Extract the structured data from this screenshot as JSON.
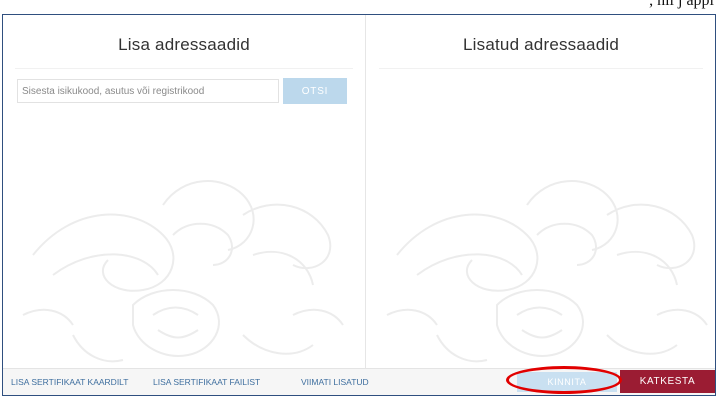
{
  "top_strip": {
    "text": ", nii j   appi"
  },
  "left_panel": {
    "title": "Lisa adressaadid",
    "search": {
      "placeholder": "Sisesta isikukood, asutus või registrikood",
      "value": ""
    },
    "search_button_label": "OTSI"
  },
  "right_panel": {
    "title": "Lisatud adressaadid"
  },
  "footer": {
    "links": [
      {
        "label": "LISA SERTIFIKAAT KAARDILT"
      },
      {
        "label": "LISA SERTIFIKAAT FAILIST"
      },
      {
        "label": "VIIMATI LISATUD"
      }
    ],
    "confirm_label": "KINNITA",
    "cancel_label": "KATKESTA"
  },
  "colors": {
    "border": "#2f4f7f",
    "link": "#3f6f9f",
    "primary_disabled": "#bcd8ec",
    "cancel": "#9b1c33",
    "highlight": "#e10000"
  },
  "icons": {
    "watermark": "coat-of-arms-lion-watermark"
  }
}
